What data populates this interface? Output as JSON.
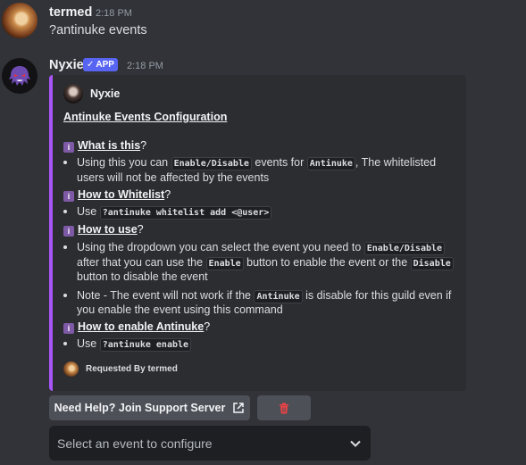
{
  "messages": {
    "user": {
      "name": "termed",
      "time": "2:18 PM",
      "text": "?antinuke events"
    },
    "bot": {
      "name": "Nyxie",
      "badge": "APP",
      "time": "2:18 PM"
    }
  },
  "embed": {
    "author": "Nyxie",
    "title": "Antinuke Events Configuration",
    "sections": {
      "what_is_this": {
        "heading": "What is this",
        "bullet_1": {
          "t1": "Using this you can ",
          "c1": "Enable/Disable",
          "t2": " events for ",
          "c2": "Antinuke",
          "t3": ", The whitelisted",
          "t4": "users will not be affected by the events"
        }
      },
      "how_to_whitelist": {
        "heading": "How to Whitelist",
        "t1": "Use ",
        "c1": "?antinuke whitelist add <@user>"
      },
      "how_to_use": {
        "heading": "How to use",
        "bullet_1": {
          "t1": "Using the dropdown you can select the event you need to ",
          "c1": "Enable/Disable",
          "t2": "after that you can use the ",
          "c2": "Enable",
          "t3": " button to enable the event or the ",
          "c3": "Disable",
          "t4": "button to disable the event"
        },
        "bullet_2": {
          "t1": "Note - The event will not work if the ",
          "c1": "Antinuke",
          "t2": " is disable for this guild even if",
          "t3": "you enable the event using this command"
        }
      },
      "how_to_enable": {
        "heading": "How to enable Antinuke",
        "t1": "Use ",
        "c1": "?antinuke enable"
      }
    },
    "question_mark": "?",
    "footer": "Requested By termed",
    "accent_color": "#a855f7"
  },
  "buttons": {
    "help_label": "Need Help? Join Support Server",
    "trash_color": "#ed4245"
  },
  "select": {
    "placeholder": "Select an event to configure"
  }
}
